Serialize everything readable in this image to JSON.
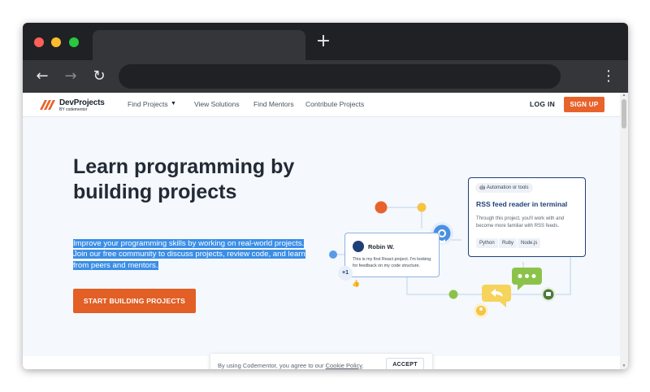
{
  "browser": {
    "new_tab_icon": "plus-icon",
    "back_icon": "arrow-left-icon",
    "forward_icon": "arrow-right-icon",
    "reload_icon": "reload-icon",
    "menu_icon": "vertical-dots-icon",
    "traffic_light_colors": [
      "#ff5f57",
      "#febc2e",
      "#28c840"
    ]
  },
  "header": {
    "logo_name": "DevProjects",
    "logo_sub": "BY codementor",
    "nav": [
      {
        "label": "Find Projects",
        "has_dropdown": true
      },
      {
        "label": "View Solutions"
      },
      {
        "label": "Find Mentors"
      },
      {
        "label": "Contribute Projects"
      }
    ],
    "login_label": "LOG IN",
    "signup_label": "SIGN UP"
  },
  "hero": {
    "title": "Learn programming by building projects",
    "description": "Improve your programming skills by working on real-world projects. Join our free community to discuss projects, review code, and learn from peers and mentors.",
    "cta_label": "START BUILDING PROJECTS"
  },
  "illustration": {
    "project_card": {
      "tag": "Automation or tools",
      "title": "RSS feed reader in terminal",
      "description": "Through this project, you'll work with and become more familiar with RSS feeds.",
      "chips": [
        "Python",
        "Ruby",
        "Node.js"
      ]
    },
    "comment_card": {
      "name": "Robin W.",
      "text": "This is my first React project. I'm looking for feedback on my code structure."
    },
    "plus_one": "+1"
  },
  "cookie_banner": {
    "text": "By using Codementor, you agree to our",
    "link": "Cookie Policy",
    "suffix": ".",
    "accept_label": "ACCEPT"
  },
  "colors": {
    "accent": "#e8632b",
    "navy": "#1f3f78",
    "highlight": "#3a8ee6",
    "page_bg": "#f5f8fc"
  }
}
